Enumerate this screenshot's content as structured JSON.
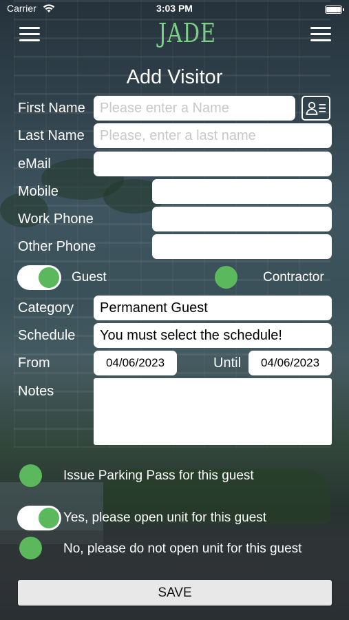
{
  "status_bar": {
    "carrier": "Carrier",
    "time": "3:03 PM"
  },
  "nav": {
    "logo": "JADE",
    "left_icon": "hamburger-menu-icon",
    "right_icon": "hamburger-menu-icon"
  },
  "page": {
    "title": "Add Visitor"
  },
  "form": {
    "first_name": {
      "label": "First Name",
      "value": "",
      "placeholder": "Please enter a Name"
    },
    "last_name": {
      "label": "Last Name",
      "value": "",
      "placeholder": "Please, enter a last name"
    },
    "email": {
      "label": "eMail",
      "value": ""
    },
    "mobile": {
      "label": "Mobile",
      "value": ""
    },
    "work_phone": {
      "label": "Work Phone",
      "value": ""
    },
    "other_phone": {
      "label": "Other Phone",
      "value": ""
    },
    "visitor_type": {
      "guest_label": "Guest",
      "guest_selected": true,
      "contractor_label": "Contractor",
      "contractor_selected": false
    },
    "category": {
      "label": "Category",
      "value": "Permanent Guest"
    },
    "schedule": {
      "label": "Schedule",
      "value": "You must select the schedule!"
    },
    "from": {
      "label": "From",
      "value": "04/06/2023"
    },
    "until": {
      "label": "Until",
      "value": "04/06/2023"
    },
    "notes": {
      "label": "Notes",
      "value": ""
    },
    "parking_pass": {
      "label": "Issue Parking Pass for this guest",
      "selected": false
    },
    "open_unit_yes": {
      "label": "Yes, please open unit for this guest",
      "selected": true
    },
    "open_unit_no": {
      "label": "No, please do not open unit for this guest",
      "selected": false
    }
  },
  "actions": {
    "save_label": "SAVE"
  },
  "colors": {
    "accent_green": "#5cb85c",
    "logo_green": "#7ccf87",
    "field_background": "#ffffff",
    "button_background": "#e8e8e8"
  }
}
